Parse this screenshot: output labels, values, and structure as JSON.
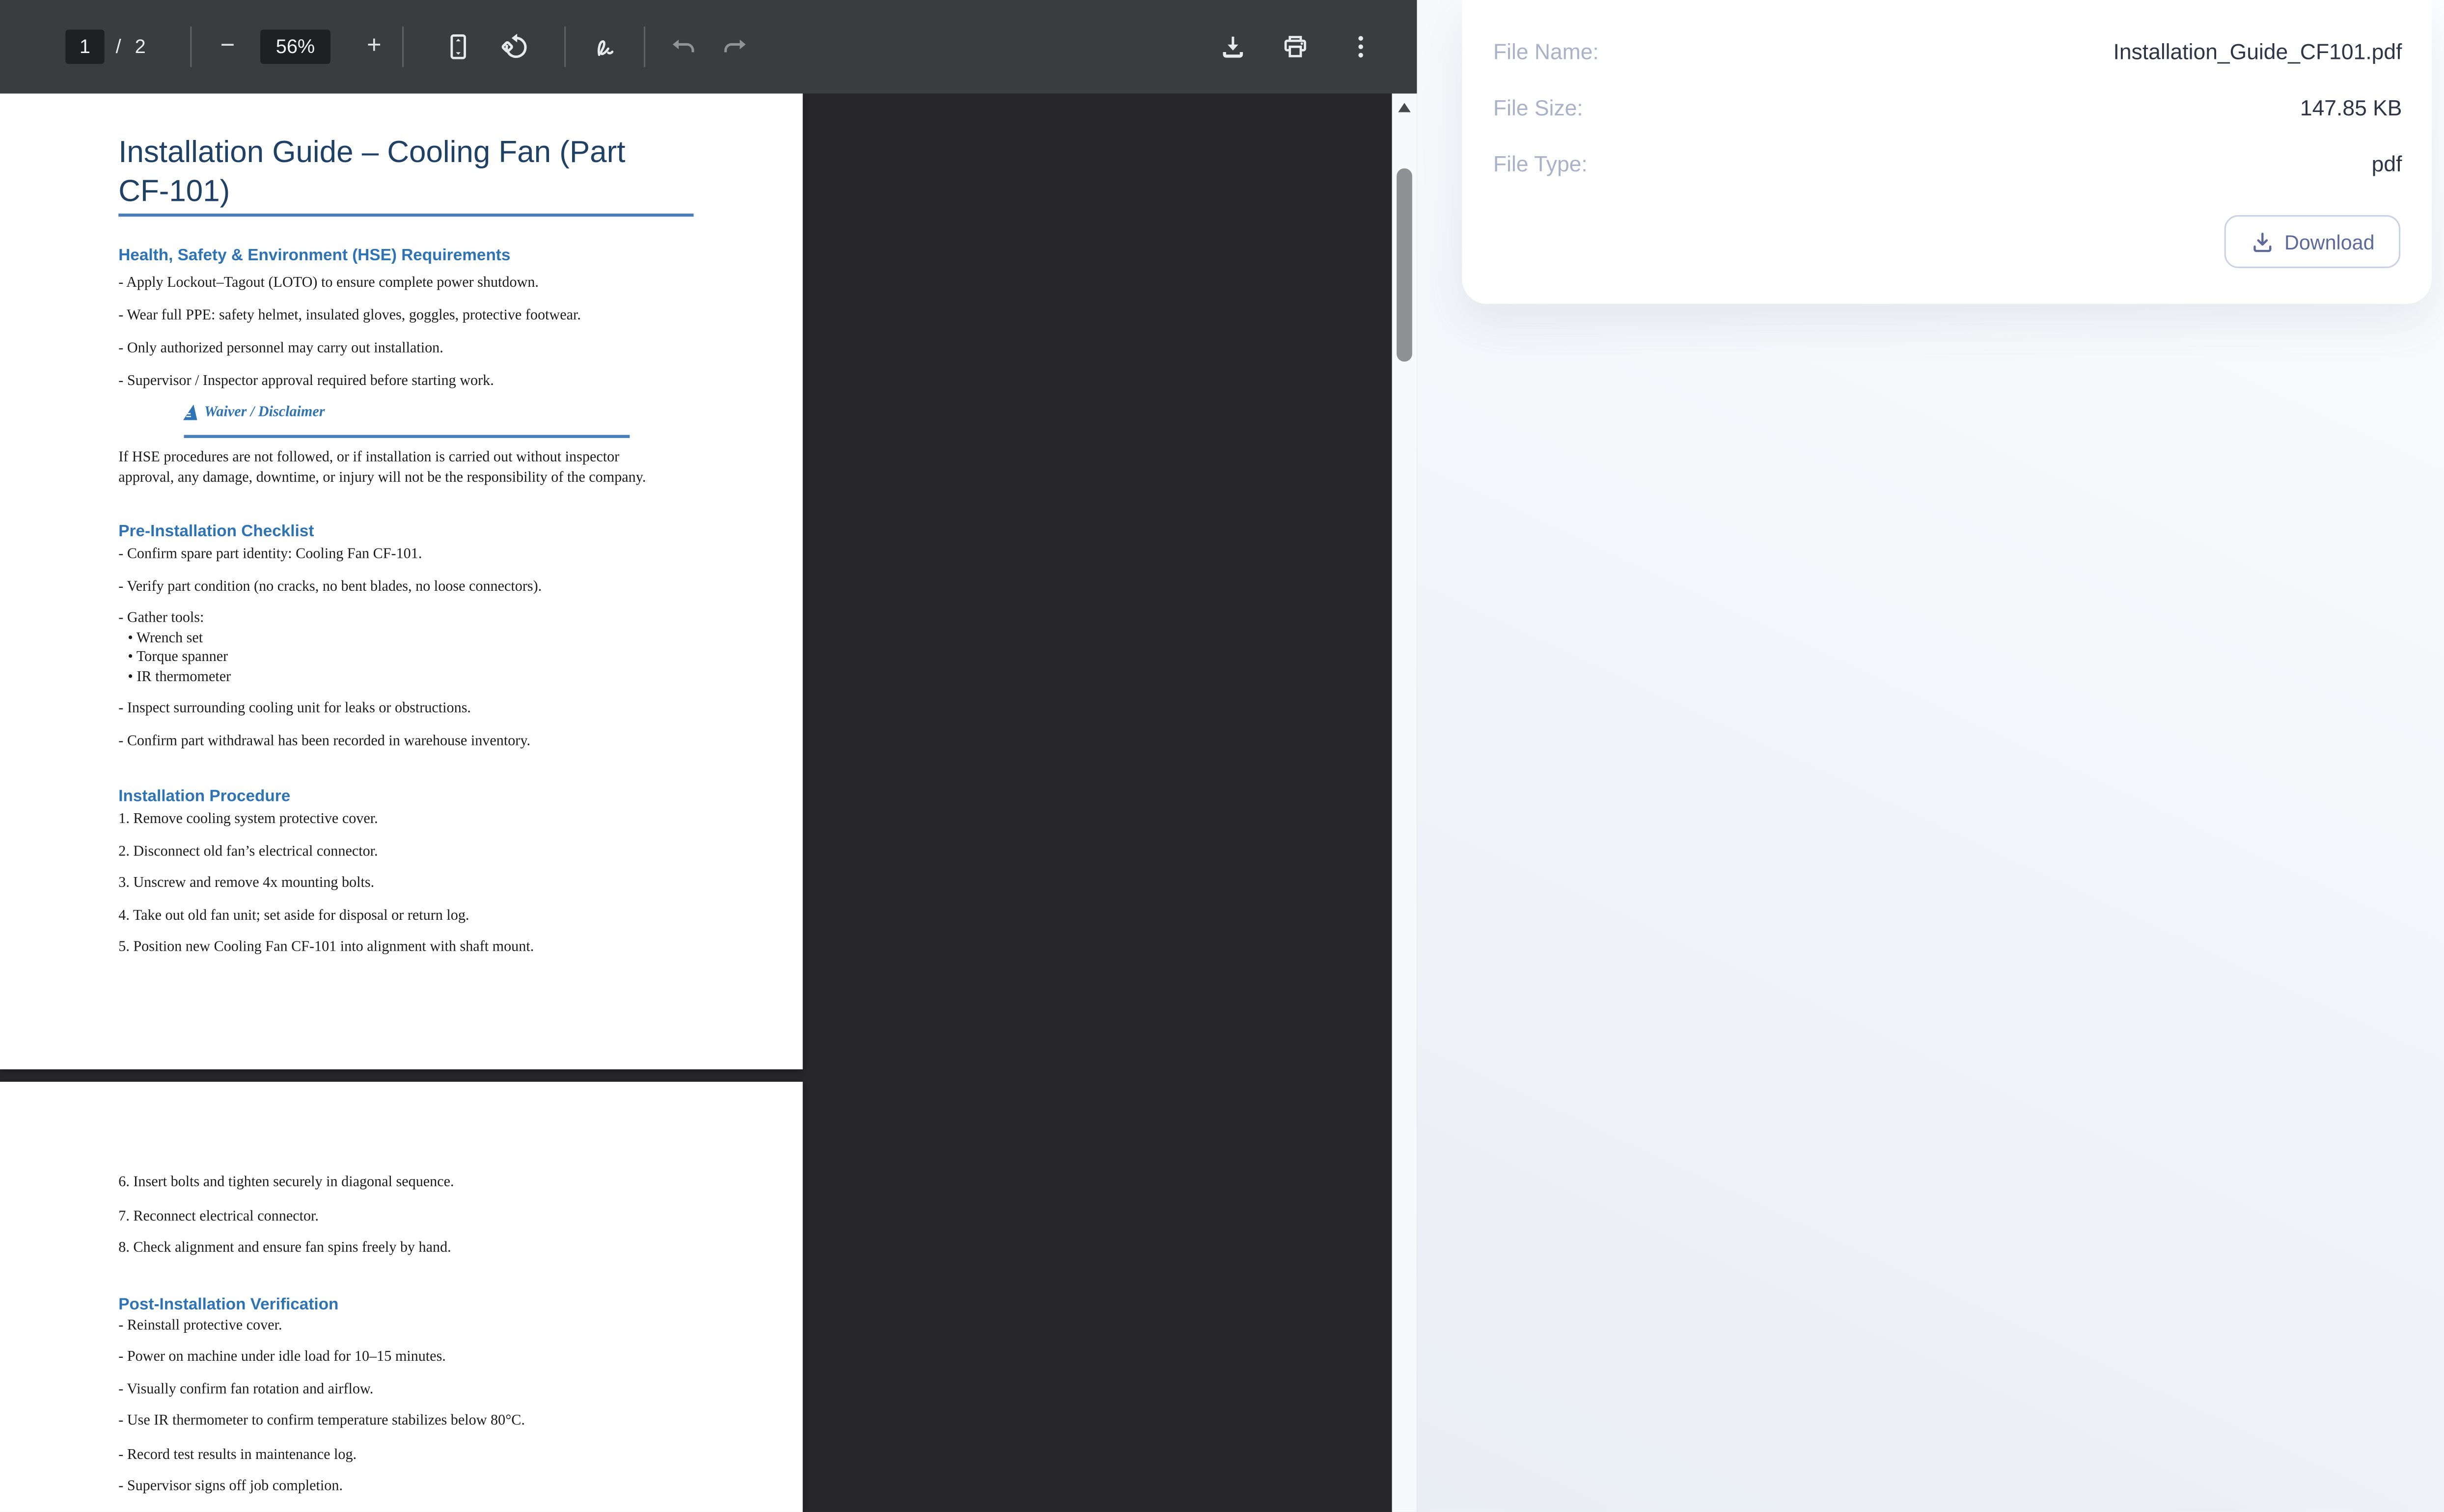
{
  "toolbar": {
    "page_current": "1",
    "page_divider": "/",
    "page_total": "2",
    "zoom_out_label": "−",
    "zoom_value": "56%",
    "zoom_in_label": "+",
    "icons": {
      "fit_page": "fit-to-page",
      "rotate": "rotate-counterclockwise",
      "annotate": "pen-squiggle",
      "undo": "undo-arrow",
      "redo": "redo-arrow",
      "download": "download-tray",
      "print": "printer",
      "more": "kebab-menu",
      "scroll_up": "▲"
    }
  },
  "document": {
    "page1": {
      "title_line1": "Installation Guide – Cooling Fan (Part",
      "title_line2": "CF-101)",
      "hse": {
        "heading": "Health, Safety & Environment (HSE) Requirements",
        "items": [
          "- Apply Lockout–Tagout (LOTO) to ensure complete power shutdown.",
          "- Wear full PPE: safety helmet, insulated gloves, goggles, protective footwear.",
          "- Only authorized personnel may carry out installation.",
          "- Supervisor / Inspector approval required before starting work."
        ]
      },
      "waiver": {
        "heading": "Waiver / Disclaimer",
        "line1": "If HSE procedures are not followed, or if installation is carried out without inspector",
        "line2": "approval, any damage, downtime, or injury will not be the responsibility of the company."
      },
      "checklist": {
        "heading": "Pre-Installation Checklist",
        "items": [
          "- Confirm spare part identity: Cooling Fan CF-101.",
          "- Verify part condition (no cracks, no bent blades, no loose connectors).",
          "- Gather tools:",
          "- Inspect surrounding cooling unit for leaks or obstructions.",
          "- Confirm part withdrawal has been recorded in warehouse inventory."
        ],
        "tools": [
          "• Wrench set",
          "• Torque spanner",
          "• IR thermometer"
        ]
      },
      "procedure": {
        "heading": "Installation Procedure",
        "steps": [
          "1. Remove cooling system protective cover.",
          "2. Disconnect old fan’s electrical connector.",
          "3. Unscrew and remove 4x mounting bolts.",
          "4. Take out old fan unit; set aside for disposal or return log.",
          "5. Position new Cooling Fan CF-101 into alignment with shaft mount."
        ]
      }
    },
    "page2": {
      "steps": [
        "6. Insert bolts and tighten securely in diagonal sequence.",
        "7. Reconnect electrical connector.",
        "8. Check alignment and ensure fan spins freely by hand."
      ],
      "verification": {
        "heading": "Post-Installation Verification",
        "items": [
          "- Reinstall protective cover.",
          "- Power on machine under idle load for 10–15 minutes.",
          "- Visually confirm fan rotation and airflow.",
          "- Use IR thermometer to confirm temperature stabilizes below 80°C.",
          "- Record test results in maintenance log.",
          "- Supervisor signs off job completion."
        ]
      }
    }
  },
  "file_panel": {
    "fields": [
      {
        "label": "File Name:",
        "value": "Installation_Guide_CF101.pdf"
      },
      {
        "label": "File Size:",
        "value": "147.85 KB"
      },
      {
        "label": "File Type:",
        "value": "pdf"
      }
    ],
    "download_label": "Download"
  },
  "colors": {
    "toolbar_bg": "#3a3d40",
    "viewer_bg": "#27272a",
    "toolbar_inset_bg": "#1e2023",
    "heading_blue": "#2e74b5",
    "title_navy": "#1f4166",
    "rule_blue": "#4a7ebb",
    "panel_label": "#a9b2c9",
    "panel_value": "#2e3547",
    "button_text": "#5b699b",
    "button_border": "#cbd2e8",
    "scroll_thumb": "#8f9194"
  }
}
